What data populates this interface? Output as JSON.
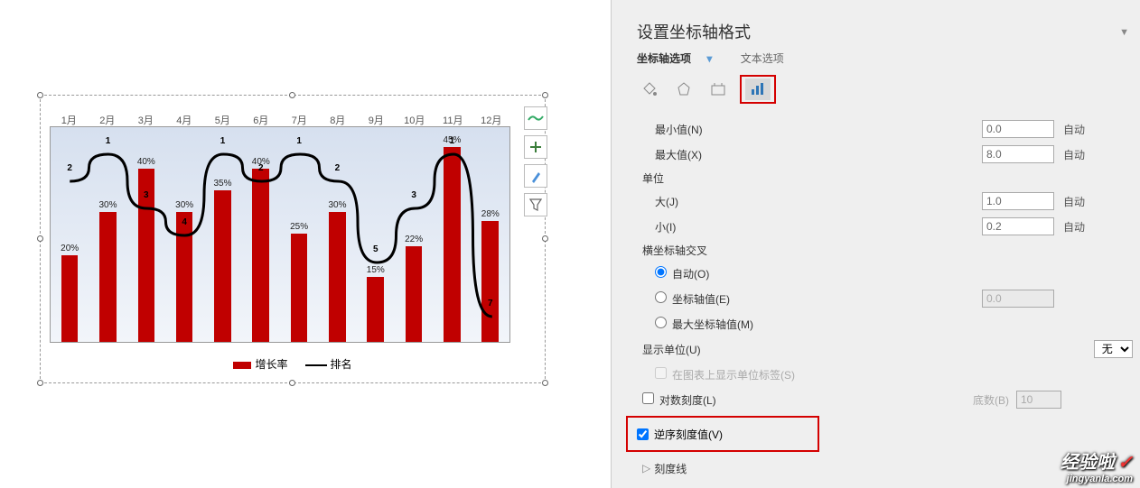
{
  "chart_data": {
    "type": "bar+line",
    "categories": [
      "1月",
      "2月",
      "3月",
      "4月",
      "5月",
      "6月",
      "7月",
      "8月",
      "9月",
      "10月",
      "11月",
      "12月"
    ],
    "series": [
      {
        "name": "增长率",
        "type": "bar",
        "values": [
          20,
          30,
          40,
          30,
          35,
          40,
          25,
          30,
          15,
          22,
          45,
          28
        ],
        "unit": "%",
        "ylim": [
          0,
          50
        ]
      },
      {
        "name": "排名",
        "type": "line",
        "values": [
          2,
          1,
          3,
          4,
          1,
          2,
          1,
          2,
          5,
          3,
          1,
          7
        ],
        "ylim": [
          8,
          0
        ]
      }
    ],
    "legend": [
      "增长率",
      "排名"
    ],
    "title": ""
  },
  "toolbar_icons": [
    "line-style-icon",
    "plus-icon",
    "brush-icon",
    "funnel-icon"
  ],
  "panel": {
    "title": "设置坐标轴格式",
    "tabs": {
      "axis_options": "坐标轴选项",
      "text_options": "文本选项"
    },
    "rows": {
      "min": {
        "label": "最小值(N)",
        "val": "0.0",
        "auto": "自动"
      },
      "max": {
        "label": "最大值(X)",
        "val": "8.0",
        "auto": "自动"
      },
      "unit": "单位",
      "major": {
        "label": "大(J)",
        "val": "1.0",
        "auto": "自动"
      },
      "minor": {
        "label": "小(I)",
        "val": "0.2",
        "auto": "自动"
      },
      "cross": "横坐标轴交叉",
      "auto_radio": "自动(O)",
      "axis_val": {
        "label": "坐标轴值(E)",
        "val": "0.0"
      },
      "max_axis": "最大坐标轴值(M)",
      "display_unit": {
        "label": "显示单位(U)",
        "val": "无"
      },
      "show_label": "在图表上显示单位标签(S)",
      "log": {
        "label": "对数刻度(L)",
        "base_label": "底数(B)",
        "base": "10"
      },
      "reverse": "逆序刻度值(V)",
      "ticks": "刻度线"
    }
  },
  "watermark": {
    "big": "经验啦",
    "check": "✓",
    "small": "jingyanla.com"
  }
}
